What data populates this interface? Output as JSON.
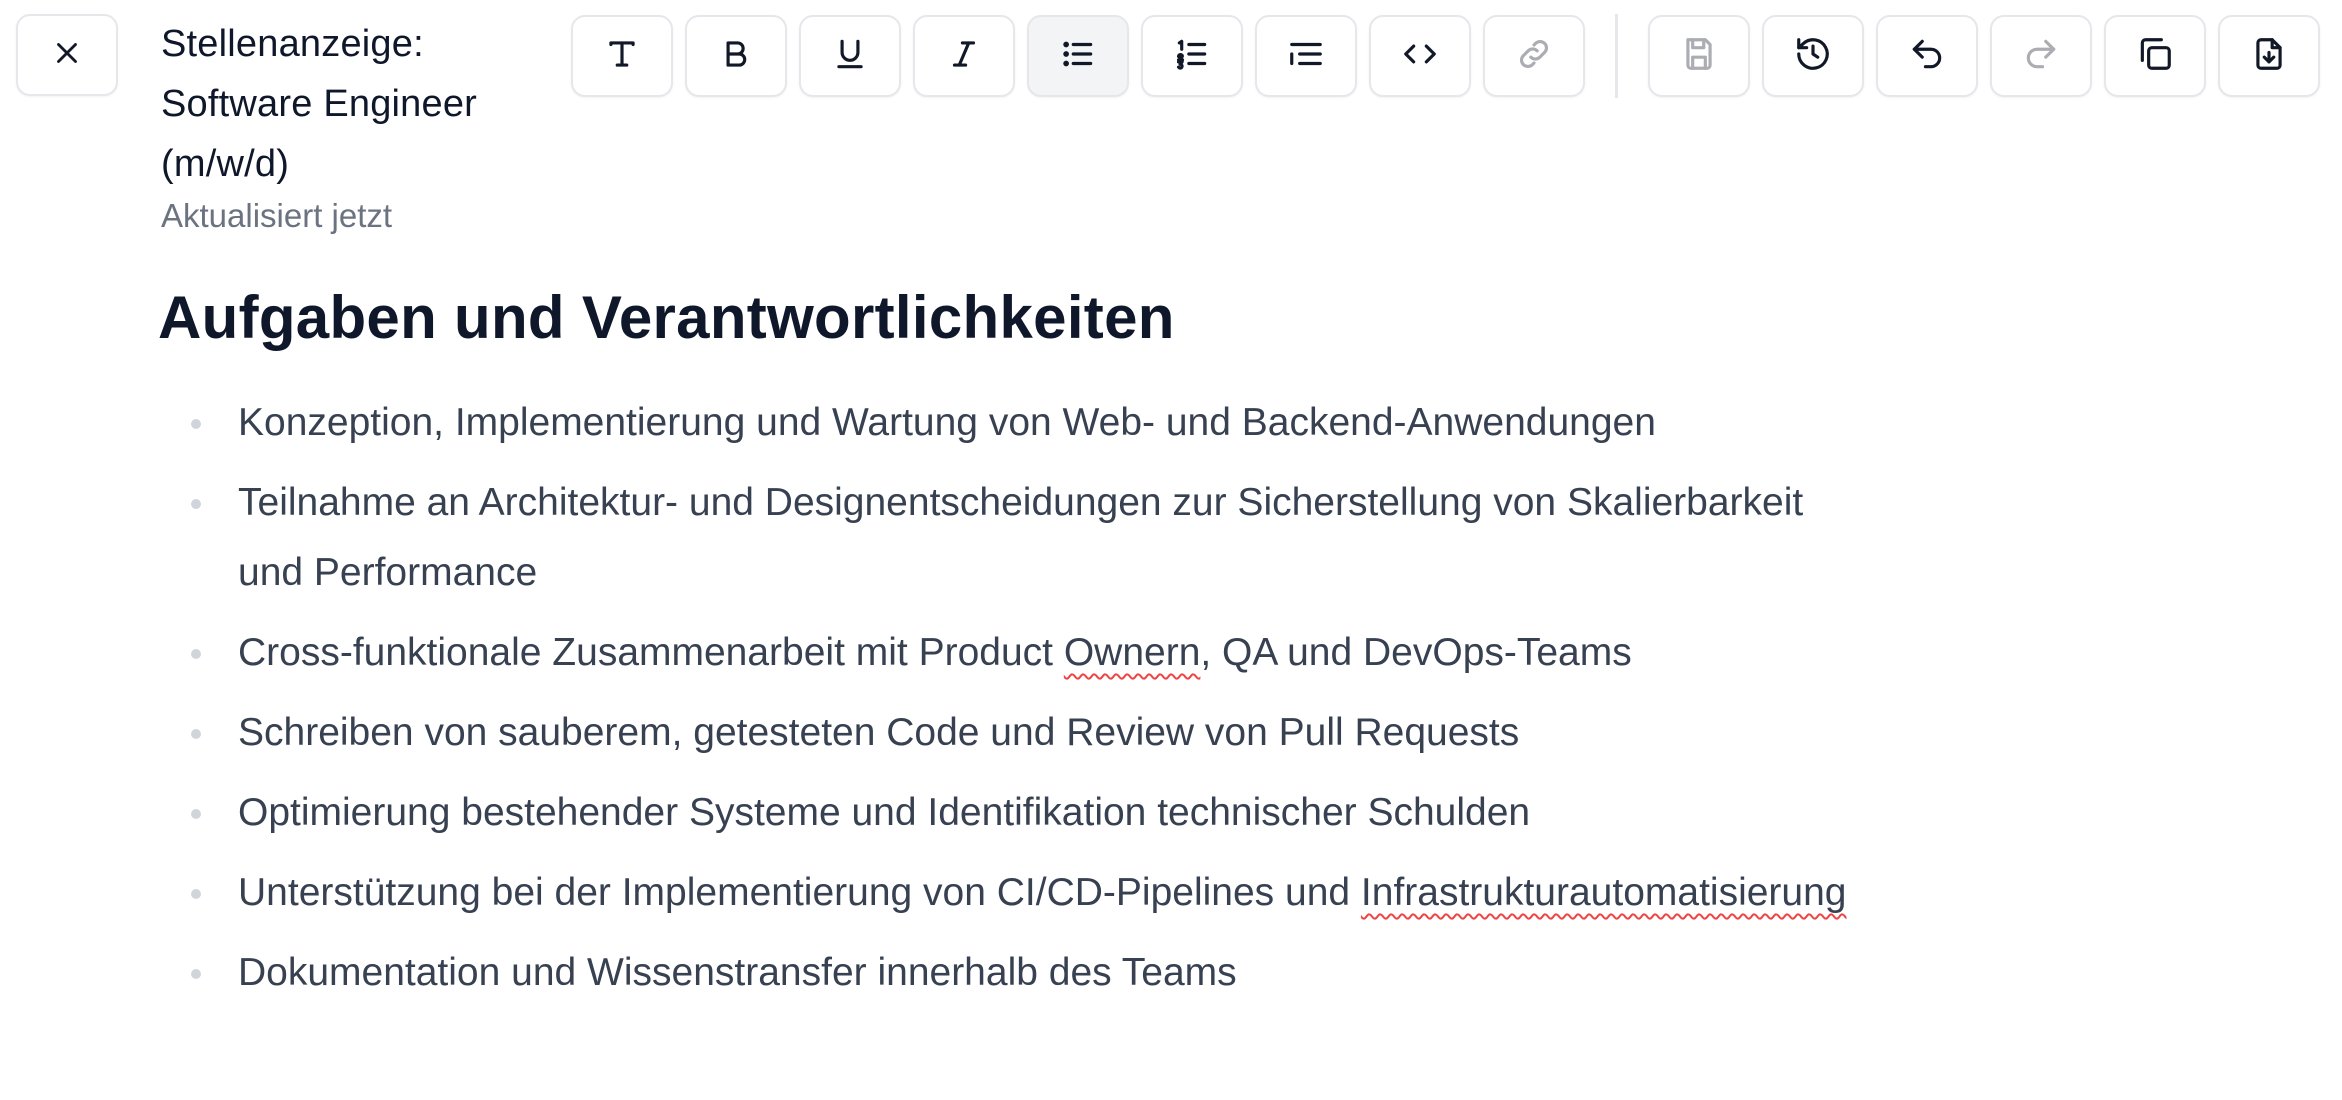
{
  "header": {
    "title": "Stellenanzeige: Software Engineer (m/w/d)",
    "status": "Aktualisiert jetzt",
    "close_icon": "close-icon"
  },
  "toolbar": {
    "buttons": [
      {
        "name": "text-style",
        "icon": "text-icon",
        "state": "normal"
      },
      {
        "name": "bold",
        "icon": "bold-icon",
        "state": "normal"
      },
      {
        "name": "underline",
        "icon": "underline-icon",
        "state": "normal"
      },
      {
        "name": "italic",
        "icon": "italic-icon",
        "state": "normal"
      },
      {
        "name": "bullet-list",
        "icon": "bullet-list-icon",
        "state": "active"
      },
      {
        "name": "numbered-list",
        "icon": "numbered-list-icon",
        "state": "normal"
      },
      {
        "name": "indent-list",
        "icon": "indent-list-icon",
        "state": "normal"
      },
      {
        "name": "code",
        "icon": "code-icon",
        "state": "normal"
      },
      {
        "name": "link",
        "icon": "link-icon",
        "state": "disabled"
      },
      {
        "name": "save",
        "icon": "save-icon",
        "state": "disabled"
      },
      {
        "name": "history",
        "icon": "history-icon",
        "state": "normal"
      },
      {
        "name": "undo",
        "icon": "undo-icon",
        "state": "normal"
      },
      {
        "name": "redo",
        "icon": "redo-icon",
        "state": "disabled"
      },
      {
        "name": "copy",
        "icon": "copy-icon",
        "state": "normal"
      },
      {
        "name": "export",
        "icon": "file-download-icon",
        "state": "normal"
      }
    ]
  },
  "content": {
    "heading": "Aufgaben und Verantwortlichkeiten",
    "items": [
      {
        "before": "Konzeption, Implementierung und Wartung von Web- und Backend-Anwendungen",
        "misspelled": "",
        "after": ""
      },
      {
        "before": "Teilnahme an Architektur- und Designentscheidungen zur Sicherstellung von Skalierbarkeit und Performance",
        "misspelled": "",
        "after": ""
      },
      {
        "before": "Cross-funktionale Zusammenarbeit mit Product ",
        "misspelled": "Ownern",
        "after": ", QA und DevOps-Teams"
      },
      {
        "before": "Schreiben von sauberem, getesteten Code und Review von Pull Requests",
        "misspelled": "",
        "after": ""
      },
      {
        "before": "Optimierung bestehender Systeme und Identifikation technischer Schulden",
        "misspelled": "",
        "after": ""
      },
      {
        "before": "Unterstützung bei der Implementierung von CI/CD-Pipelines und ",
        "misspelled": "Infrastrukturautomatisierung",
        "after": ""
      },
      {
        "before": "Dokumentation und Wissenstransfer innerhalb des Teams",
        "misspelled": "",
        "after": ""
      }
    ]
  },
  "colors": {
    "text_primary": "#0f172a",
    "text_body": "#374151",
    "text_muted": "#6b7280",
    "border": "#e5e7eb",
    "active_bg": "#f3f4f6",
    "spellcheck": "#ef4444"
  }
}
